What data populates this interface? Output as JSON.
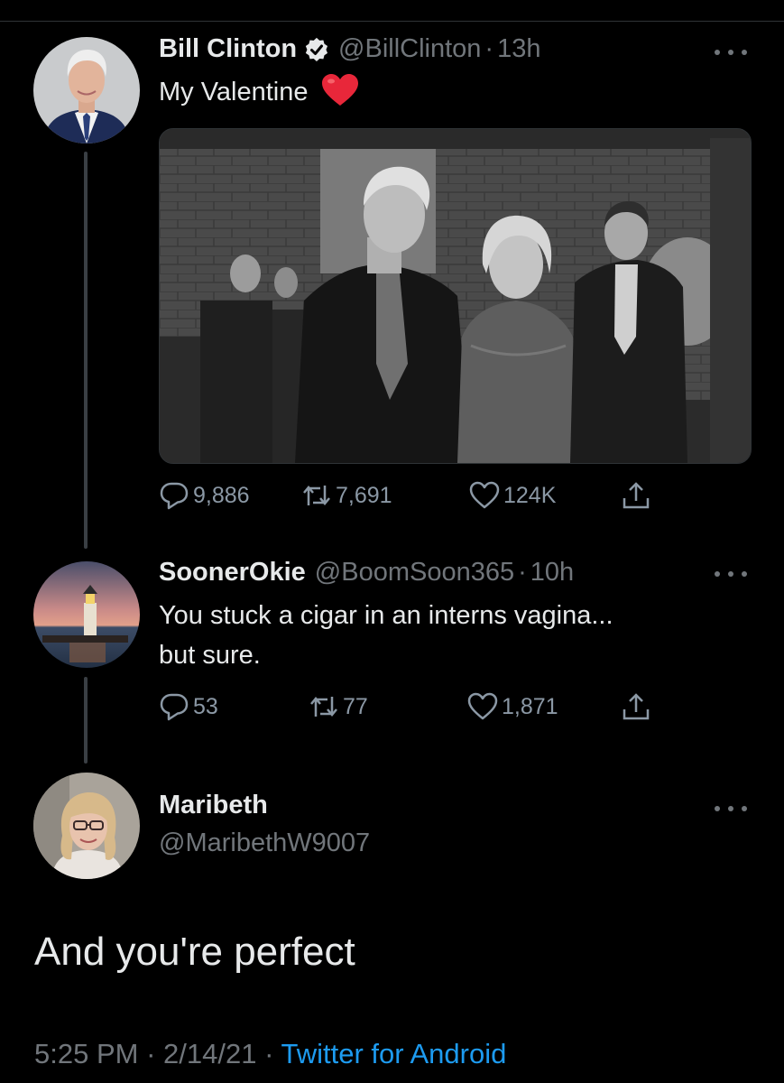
{
  "tweet1": {
    "name": "Bill Clinton",
    "handle": "@BillClinton",
    "dot": "·",
    "time": "13h",
    "text": "My Valentine",
    "replies": "9,886",
    "retweets": "7,691",
    "likes": "124K"
  },
  "tweet2": {
    "name": "SoonerOkie",
    "handle": "@BoomSoon365",
    "dot": "·",
    "time": "10h",
    "text_line1": "You stuck a cigar in an interns vagina...",
    "text_line2": "but sure.",
    "replies": "53",
    "retweets": "77",
    "likes": "1,871"
  },
  "tweet3": {
    "name": "Maribeth",
    "handle": "@MaribethW9007",
    "text": "And you're perfect",
    "time": "5:25 PM",
    "sep1": "·",
    "date": "2/14/21",
    "sep2": "·",
    "source": "Twitter for Android"
  },
  "icons": {
    "reply": "reply-icon",
    "retweet": "retweet-icon",
    "like": "heart-icon",
    "share": "share-icon",
    "more": "more-icon",
    "verified": "verified-badge-icon"
  },
  "colors": {
    "background": "#000000",
    "text": "#e7e9ea",
    "secondary": "#71767b",
    "link": "#1d9bf0",
    "heart_emoji": "#e8273a"
  }
}
